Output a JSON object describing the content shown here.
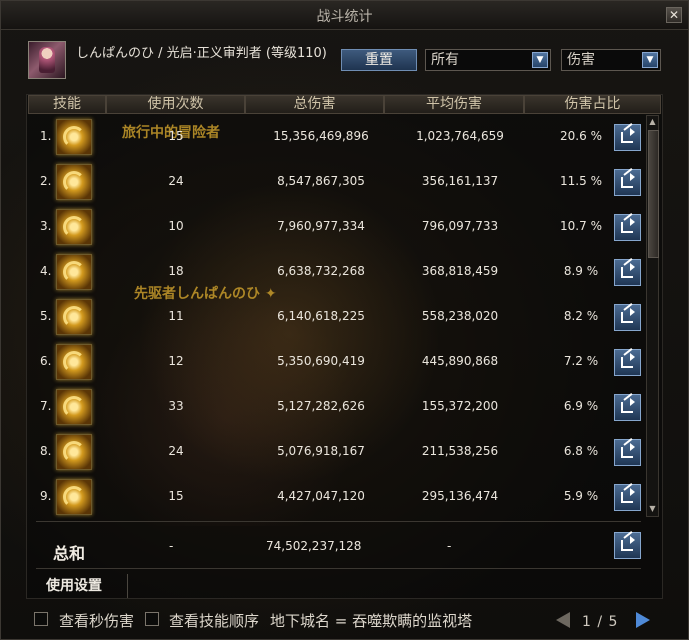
{
  "window": {
    "title": "战斗统计",
    "close_label": "✕"
  },
  "header": {
    "player_name": "しんぱんのひ / 光启·正义审判者 (等级110)",
    "reset_label": "重置",
    "filter_all": "所有",
    "filter_type": "伤害"
  },
  "table": {
    "columns": [
      "技能",
      "使用次数",
      "总伤害",
      "平均伤害",
      "伤害占比"
    ],
    "rows": [
      {
        "rank": "1.",
        "icon": "skill-icon-vortex",
        "uses": "15",
        "total": "15,356,469,896",
        "avg": "1,023,764,659",
        "pct": "20.6 %"
      },
      {
        "rank": "2.",
        "icon": "skill-icon-slash-waves",
        "uses": "24",
        "total": "8,547,867,305",
        "avg": "356,161,137",
        "pct": "11.5 %"
      },
      {
        "rank": "3.",
        "icon": "skill-icon-lightning",
        "uses": "10",
        "total": "7,960,977,334",
        "avg": "796,097,733",
        "pct": "10.7 %"
      },
      {
        "rank": "4.",
        "icon": "skill-icon-beam",
        "uses": "18",
        "total": "6,638,732,268",
        "avg": "368,818,459",
        "pct": "8.9 %"
      },
      {
        "rank": "5.",
        "icon": "skill-icon-cross-slash",
        "uses": "11",
        "total": "6,140,618,225",
        "avg": "558,238,020",
        "pct": "8.2 %"
      },
      {
        "rank": "6.",
        "icon": "skill-icon-flame",
        "uses": "12",
        "total": "5,350,690,419",
        "avg": "445,890,868",
        "pct": "7.2 %"
      },
      {
        "rank": "7.",
        "icon": "skill-icon-thorns",
        "uses": "33",
        "total": "5,127,282,626",
        "avg": "155,372,200",
        "pct": "6.9 %"
      },
      {
        "rank": "8.",
        "icon": "skill-icon-spiral-strike",
        "uses": "24",
        "total": "5,076,918,167",
        "avg": "211,538,256",
        "pct": "6.8 %"
      },
      {
        "rank": "9.",
        "icon": "skill-icon-swirl",
        "uses": "15",
        "total": "4,427,047,120",
        "avg": "295,136,474",
        "pct": "5.9 %"
      }
    ],
    "overlay_texts": [
      "旅行中的冒险者",
      "先驱者しんぱんのひ ✦"
    ]
  },
  "summary": {
    "label": "总和",
    "uses": "-",
    "total": "74,502,237,128",
    "avg": "-"
  },
  "footer": {
    "settings_tab": "使用设置",
    "check_per_second": "查看秒伤害",
    "check_skill_order": "查看技能顺序",
    "dungeon_label": "地下城名 = 吞噬欺瞒的监视塔",
    "page_indicator": "1 / 5"
  },
  "colors": {
    "accent_blue": "#4f6f97",
    "header_bg": "#2e2924",
    "icon_gold": "#d39a1e"
  }
}
